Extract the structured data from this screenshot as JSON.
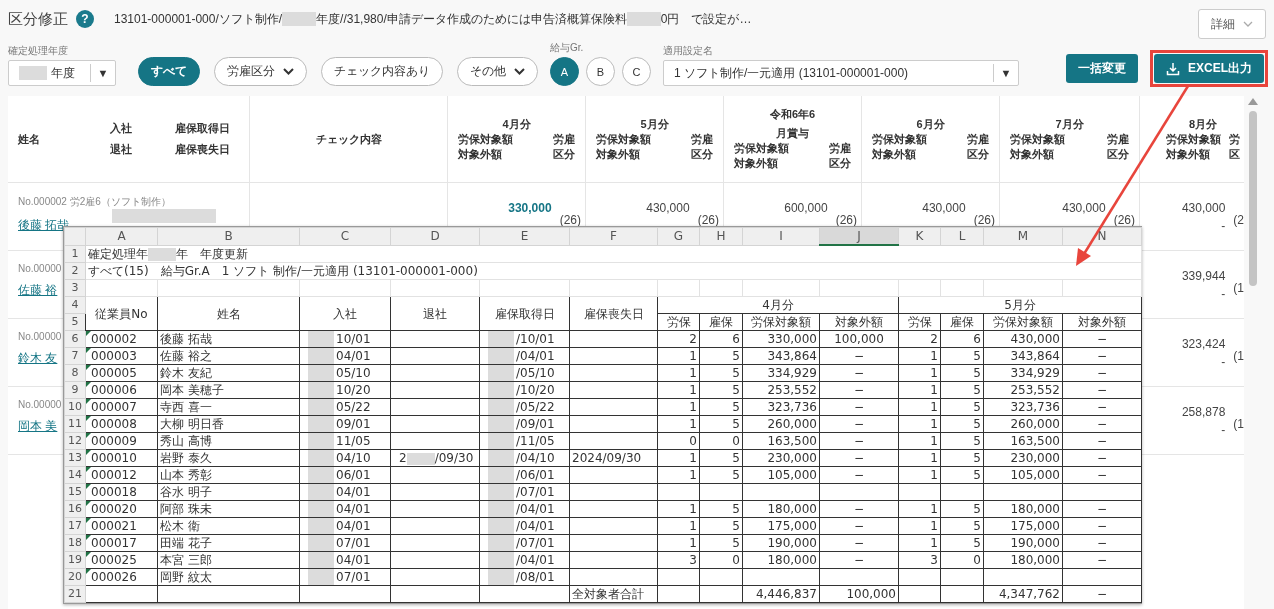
{
  "header": {
    "title": "区分修正",
    "help_icon": "?",
    "info": [
      "13101-000001-000/ソフト制作/",
      "年度//31,980/申請データ作成のためには申告済概算保険料",
      "0円　で設定が…"
    ],
    "detail_button": "詳細"
  },
  "filters": {
    "year_label": "確定処理年度",
    "year_value": "年度",
    "select_arrow": "▼",
    "chips": [
      {
        "label": "すべて",
        "selected": true,
        "kind": "toggle"
      },
      {
        "label": "労雇区分",
        "selected": false,
        "kind": "dropdown"
      },
      {
        "label": "チェック内容あり",
        "selected": false,
        "kind": "toggle"
      },
      {
        "label": "その他",
        "selected": false,
        "kind": "dropdown"
      }
    ],
    "group_label": "給与Gr.",
    "groups": [
      {
        "label": "A",
        "selected": true
      },
      {
        "label": "B",
        "selected": false
      },
      {
        "label": "C",
        "selected": false
      }
    ],
    "setting_label": "適用設定名",
    "setting_value": "1 ソフト制作/一元適用 (13101-000001-000)",
    "bulk_button": "一括変更",
    "export_button": {
      "label": "EXCEL出力",
      "highlighted": true
    }
  },
  "table": {
    "name_header": "姓名",
    "join_header": "入社",
    "leave_header": "退社",
    "acquired_header": "雇保取得日",
    "lost_header": "雇保喪失日",
    "check_header": "チェック内容",
    "months": [
      {
        "title_lines": [
          "4月分"
        ],
        "amount_lines": [
          "労保対象額",
          "対象外額"
        ],
        "class_lines": [
          "労雇",
          "区分"
        ]
      },
      {
        "title_lines": [
          "5月分"
        ],
        "amount_lines": [
          "労保対象額",
          "対象外額"
        ],
        "class_lines": [
          "労雇",
          "区分"
        ]
      },
      {
        "title_lines": [
          "令和6年6",
          "月賞与"
        ],
        "amount_lines": [
          "労保対象額",
          "対象外額"
        ],
        "class_lines": [
          "労雇",
          "区分"
        ]
      },
      {
        "title_lines": [
          "6月分"
        ],
        "amount_lines": [
          "労保対象額",
          "対象外額"
        ],
        "class_lines": [
          "労雇",
          "区分"
        ]
      },
      {
        "title_lines": [
          "7月分"
        ],
        "amount_lines": [
          "労保対象額",
          "対象外額"
        ],
        "class_lines": [
          "労雇",
          "区分"
        ]
      },
      {
        "title_lines": [
          "8月分"
        ],
        "amount_lines": [
          "労保対象額",
          "対象外額"
        ],
        "class_lines": [
          "労",
          "区"
        ]
      }
    ],
    "rows": [
      {
        "number": "No.000002 労2雇6（ソフト制作）",
        "name": "後藤 拓哉",
        "cells": [
          {
            "amount": "330,000",
            "class": "(26)",
            "highlighted": true
          },
          {
            "amount": "430,000",
            "class": "(26)",
            "highlighted": false
          },
          {
            "amount": "600,000",
            "class": "(26)",
            "highlighted": false
          },
          {
            "amount": "430,000",
            "class": "(26)",
            "highlighted": false
          },
          {
            "amount": "430,000",
            "class": "(26)",
            "highlighted": false
          },
          {
            "amount": "430,000",
            "excluded": "-",
            "class": "(2",
            "highlighted": false
          }
        ]
      },
      {
        "number": "No.00000",
        "name": "佐藤 裕",
        "cells": [
          null,
          null,
          null,
          null,
          null,
          {
            "amount": "339,944",
            "excluded": "-",
            "class": "(1",
            "highlighted": false
          }
        ]
      },
      {
        "number": "No.00000",
        "name": "鈴木 友",
        "cells": [
          null,
          null,
          null,
          null,
          null,
          {
            "amount": "323,424",
            "excluded": "-",
            "class": "(1",
            "highlighted": false
          }
        ]
      },
      {
        "number": "No.00000",
        "name": "岡本 美",
        "cells": [
          null,
          null,
          null,
          null,
          null,
          {
            "amount": "258,878",
            "excluded": "-",
            "class": "(1",
            "highlighted": false
          }
        ]
      }
    ]
  },
  "sheet": {
    "columns": [
      {
        "letter": "A",
        "selected": false
      },
      {
        "letter": "B",
        "selected": false
      },
      {
        "letter": "C",
        "selected": false
      },
      {
        "letter": "D",
        "selected": false
      },
      {
        "letter": "E",
        "selected": false
      },
      {
        "letter": "F",
        "selected": false
      },
      {
        "letter": "G",
        "selected": false
      },
      {
        "letter": "H",
        "selected": false
      },
      {
        "letter": "I",
        "selected": false
      },
      {
        "letter": "J",
        "selected": true
      },
      {
        "letter": "K",
        "selected": false
      },
      {
        "letter": "L",
        "selected": false
      },
      {
        "letter": "M",
        "selected": false
      },
      {
        "letter": "N",
        "selected": false
      }
    ],
    "row_numbers": [
      "1",
      "2",
      "3",
      "4",
      "5",
      "6",
      "7",
      "8",
      "9",
      "10",
      "11",
      "12",
      "13",
      "14",
      "15",
      "16",
      "17",
      "18",
      "19",
      "20",
      "21"
    ],
    "title_parts": [
      "確定処理年",
      "年　年度更新"
    ],
    "subtitle": "すべて(15)　給与Gr.A　1 ソフト 制作/一元適用 (13101-000001-000)",
    "headers": [
      "従業員No",
      "姓名",
      "入社",
      "退社",
      "雇保取得日",
      "雇保喪失日"
    ],
    "month_groups": [
      {
        "title": "4月分",
        "subs": [
          "労保",
          "雇保",
          "労保対象額",
          "対象外額"
        ]
      },
      {
        "title": "5月分",
        "subs": [
          "労保",
          "雇保",
          "労保対象額",
          "対象外額"
        ]
      }
    ],
    "rows": [
      {
        "no": "000002",
        "name": "後藤 拓哉",
        "join": "10/01",
        "acquired": "/10/01",
        "values": [
          "2",
          "6",
          "330,000",
          "100,000",
          "2",
          "6",
          "430,000",
          "−"
        ]
      },
      {
        "no": "000003",
        "name": "佐藤 裕之",
        "join": "04/01",
        "acquired": "/04/01",
        "values": [
          "1",
          "5",
          "343,864",
          "−",
          "1",
          "5",
          "343,864",
          "−"
        ]
      },
      {
        "no": "000005",
        "name": "鈴木 友紀",
        "join": "05/10",
        "acquired": "/05/10",
        "values": [
          "1",
          "5",
          "334,929",
          "−",
          "1",
          "5",
          "334,929",
          "−"
        ]
      },
      {
        "no": "000006",
        "name": "岡本 美穂子",
        "join": "10/20",
        "acquired": "/10/20",
        "values": [
          "1",
          "5",
          "253,552",
          "−",
          "1",
          "5",
          "253,552",
          "−"
        ]
      },
      {
        "no": "000007",
        "name": "寺西 喜一",
        "join": "05/22",
        "acquired": "/05/22",
        "values": [
          "1",
          "5",
          "323,736",
          "−",
          "1",
          "5",
          "323,736",
          "−"
        ]
      },
      {
        "no": "000008",
        "name": "大柳 明日香",
        "join": "09/01",
        "acquired": "/09/01",
        "values": [
          "1",
          "5",
          "260,000",
          "−",
          "1",
          "5",
          "260,000",
          "−"
        ]
      },
      {
        "no": "000009",
        "name": "秀山 高博",
        "join": "11/05",
        "acquired": "/11/05",
        "values": [
          "0",
          "0",
          "163,500",
          "−",
          "1",
          "5",
          "163,500",
          "−"
        ]
      },
      {
        "no": "000010",
        "name": "岩野 泰久",
        "join": "04/10",
        "leave_parts": [
          "2",
          "/09/30"
        ],
        "acquired": "/04/10",
        "lost": "2024/09/30",
        "values": [
          "1",
          "5",
          "230,000",
          "−",
          "1",
          "5",
          "230,000",
          "−"
        ]
      },
      {
        "no": "000012",
        "name": "山本 秀彰",
        "join": "06/01",
        "acquired": "/06/01",
        "values": [
          "1",
          "5",
          "105,000",
          "−",
          "1",
          "5",
          "105,000",
          "−"
        ]
      },
      {
        "no": "000018",
        "name": "谷水 明子",
        "join": "04/01",
        "acquired": "/07/01"
      },
      {
        "no": "000020",
        "name": "阿部 珠未",
        "join": "04/01",
        "acquired": "/04/01",
        "values": [
          "1",
          "5",
          "180,000",
          "−",
          "1",
          "5",
          "180,000",
          "−"
        ]
      },
      {
        "no": "000021",
        "name": "松木 衛",
        "join": "04/01",
        "acquired": "/04/01",
        "values": [
          "1",
          "5",
          "175,000",
          "−",
          "1",
          "5",
          "175,000",
          "−"
        ]
      },
      {
        "no": "000017",
        "name": "田端 花子",
        "join": "07/01",
        "acquired": "/07/01",
        "values": [
          "1",
          "5",
          "190,000",
          "−",
          "1",
          "5",
          "190,000",
          "−"
        ]
      },
      {
        "no": "000025",
        "name": "本宮 三郎",
        "join": "04/01",
        "acquired": "/04/01",
        "values": [
          "3",
          "0",
          "180,000",
          "−",
          "3",
          "0",
          "180,000",
          "−"
        ]
      },
      {
        "no": "000026",
        "name": "岡野 紋太",
        "join": "07/01",
        "acquired": "/08/01"
      }
    ],
    "total": {
      "label": "全対象者合計",
      "apr_amount": "4,446,837",
      "apr_excluded": "100,000",
      "may_amount": "4,347,762",
      "may_excluded": "−"
    }
  }
}
